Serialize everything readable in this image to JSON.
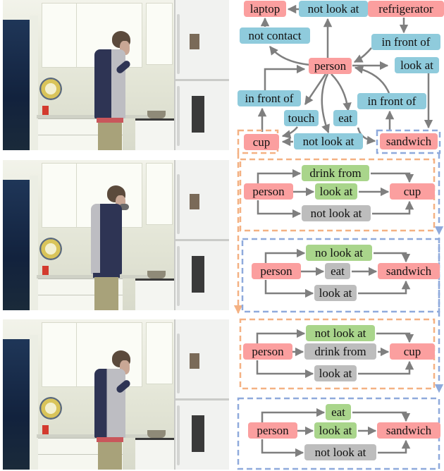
{
  "figure": {
    "description": "Video frames of a person in a kitchen paired with a spatio-temporal scene graph and per-frame relationship graphs",
    "colors": {
      "object_node": "#fb9f9f",
      "relation_node": "#8fcbdc",
      "positive_relation": "#a9d58b",
      "negative_relation": "#bdbdbd",
      "edge": "#7f7f7f",
      "cup_highlight": "#f4b183",
      "sandwich_highlight": "#8faadc"
    }
  },
  "frames": [
    {
      "label": "frame-1",
      "scene": "person in hoodie standing at kitchen counter holding food to mouth"
    },
    {
      "label": "frame-2",
      "scene": "person drinking from a cup in the kitchen"
    },
    {
      "label": "frame-3",
      "scene": "person eating a sandwich in the kitchen"
    }
  ],
  "scene_graph": {
    "nodes": {
      "laptop": "laptop",
      "rel_not_look_at_laptop": "not look at",
      "refrigerator": "refrigerator",
      "rel_not_contact": "not contact",
      "rel_in_front_of_fridge": "in front of",
      "person": "person",
      "rel_look_at": "look at",
      "rel_in_front_of_cup": "in front of",
      "rel_in_front_of_sandwich": "in front of",
      "rel_touch": "touch",
      "rel_eat": "eat",
      "cup": "cup",
      "rel_not_look_at_cup": "not look at",
      "sandwich": "sandwich"
    }
  },
  "subgraphs": [
    {
      "highlight": "cup",
      "subject": "person",
      "object": "cup",
      "relations": [
        {
          "label": "drink from",
          "type": "positive"
        },
        {
          "label": "look at",
          "type": "positive"
        },
        {
          "label": "not look at",
          "type": "negative"
        }
      ]
    },
    {
      "highlight": "sandwich",
      "subject": "person",
      "object": "sandwich",
      "relations": [
        {
          "label": "no look at",
          "type": "positive"
        },
        {
          "label": "eat",
          "type": "negative"
        },
        {
          "label": "look at",
          "type": "negative"
        }
      ]
    },
    {
      "highlight": "cup",
      "subject": "person",
      "object": "cup",
      "relations": [
        {
          "label": "not look at",
          "type": "positive"
        },
        {
          "label": "drink from",
          "type": "negative"
        },
        {
          "label": "look at",
          "type": "negative"
        }
      ]
    },
    {
      "highlight": "sandwich",
      "subject": "person",
      "object": "sandwich",
      "relations": [
        {
          "label": "eat",
          "type": "positive"
        },
        {
          "label": "look at",
          "type": "positive"
        },
        {
          "label": "not look at",
          "type": "negative"
        }
      ]
    }
  ]
}
